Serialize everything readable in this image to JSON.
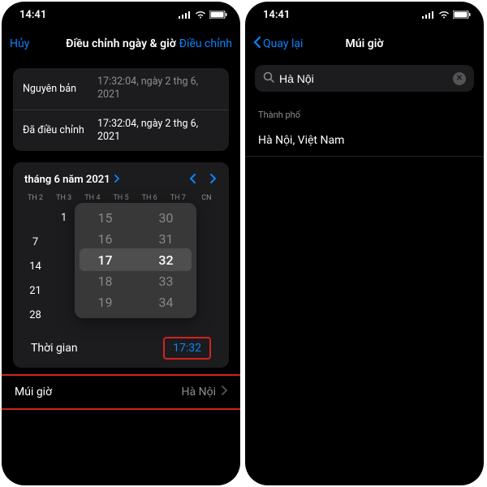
{
  "status": {
    "time": "14:41"
  },
  "left": {
    "nav": {
      "cancel": "Hủy",
      "title": "Điều chỉnh ngày & giờ",
      "action": "Điều chỉnh"
    },
    "info": {
      "original_label": "Nguyên bản",
      "original_value": "17:32:04, ngày 2 thg 6, 2021",
      "adjusted_label": "Đã điều chỉnh",
      "adjusted_value": "17:32:04, ngày 2 thg 6, 2021"
    },
    "calendar": {
      "title": "tháng 6 năm 2021",
      "dow": [
        "TH 2",
        "TH 3",
        "TH 4",
        "TH 5",
        "TH 6",
        "TH 7",
        "CN"
      ],
      "rows": [
        [
          "",
          "1",
          "",
          "",
          "",
          "",
          ""
        ],
        [
          "7",
          "",
          "",
          "",
          "",
          "",
          ""
        ],
        [
          "14",
          "",
          "",
          "",
          "",
          "",
          ""
        ],
        [
          "21",
          "",
          "",
          "",
          "",
          "",
          ""
        ],
        [
          "28",
          "",
          "",
          "",
          "",
          "",
          ""
        ]
      ]
    },
    "picker": {
      "hours": [
        "15",
        "16",
        "17",
        "18",
        "19"
      ],
      "mins": [
        "30",
        "31",
        "32",
        "33",
        "34"
      ]
    },
    "time_label": "Thời gian",
    "time_value": "17:32",
    "tz_label": "Múi giờ",
    "tz_value": "Hà Nội"
  },
  "right": {
    "nav": {
      "back": "Quay lại",
      "title": "Múi giờ"
    },
    "search_value": "Hà Nội",
    "section": "Thành phố",
    "result": "Hà Nội, Việt Nam"
  }
}
